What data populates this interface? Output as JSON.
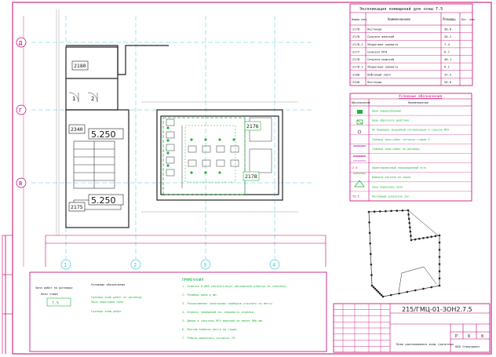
{
  "explication": {
    "title": "Экспликация помещений для зоны 7.5",
    "headers": [
      "Номер пом.",
      "Наименование",
      "Площадь",
      "Кат. пом."
    ],
    "rows": [
      [
        "2178",
        "Лестница",
        "30.8",
        ""
      ],
      [
        "2178",
        "Санузел женский",
        "28.2",
        ""
      ],
      [
        "2178.1",
        "Уборочная комната",
        "7.4",
        ""
      ],
      [
        "2177",
        "Санузел МГН",
        "6.7",
        ""
      ],
      [
        "2178",
        "Санузел мужской",
        "40.1",
        ""
      ],
      [
        "2178.1",
        "Уборочная комната",
        "6.1",
        ""
      ],
      [
        "2180",
        "Лифтовый холл",
        "37.5",
        ""
      ],
      [
        "2340",
        "Лестница",
        "26.6",
        ""
      ]
    ]
  },
  "legend": {
    "title": "Условные обозначения",
    "headers": [
      "Обозначение",
      "Наименование"
    ],
    "items": [
      {
        "symbol": "",
        "text": "Кран водоразборный"
      },
      {
        "symbol": "",
        "text": "Кран обратного действия"
      },
      {
        "symbol": "",
        "text": "ПУ Подводка аварийной сигнализации к санузлу МГН"
      },
      {
        "symbol": "",
        "text": "Граница зоны работ согласно стадии П"
      },
      {
        "symbol": "",
        "text": "Граница зоны работ по договору"
      },
      {
        "symbol": "",
        "text": ""
      },
      {
        "symbol": "2.5",
        "text": "Ориентировочный эвакуационный путь"
      },
      {
        "symbol": "",
        "text": "Кабинка санузла по серии"
      },
      {
        "symbol": "",
        "text": "Зона подогрева пола"
      },
      {
        "symbol": "T3.5",
        "text": "Поэтажный указатель зон"
      }
    ]
  },
  "plan": {
    "axes_left": [
      "Д",
      "Г",
      "В"
    ],
    "axes_bottom": [
      "1",
      "2",
      "3",
      "4"
    ],
    "rooms": {
      "r2180": "2180",
      "r2340": "2340",
      "r2175": "2175",
      "r2176": "2176",
      "r2178": "2178"
    },
    "levels": [
      "5.250",
      "5.250"
    ],
    "doors": [
      "1",
      "2"
    ]
  },
  "notes": {
    "block_title": "ПРИМЕЧАНИЯ",
    "left_label": "Зона работ по договору",
    "left_sub": "План этажа",
    "left_mark": "7.5",
    "col2_title": "Условные обозначения",
    "col2_line1": "Граница зоны работ по договору",
    "col2_line2": "Зона подогрева пола",
    "col2_line3": "Граница зоны работ",
    "paragraphs": [
      "1. Отметка 0.000 соответствует абсолютной отметке по генплану.",
      "2. Размеры даны в мм.",
      "3. Расположение санитарных приборов уточнить по месту.",
      "4. Отделку помещений см. ведомость отделки.",
      "5. Двери в санузлах МГН шириной не менее 900 мм.",
      "6. Монтаж кабинок вести по серии.",
      "7. Работы выполнять согласно СП."
    ]
  },
  "title_block": {
    "code": "215/ГМЦ-01-ЗОН2.7.5",
    "sheet_name": "План расположения зоны туалетных",
    "stage": "Р",
    "sheet": "8",
    "sheets": "8",
    "company": "ООО Спецпроект"
  }
}
